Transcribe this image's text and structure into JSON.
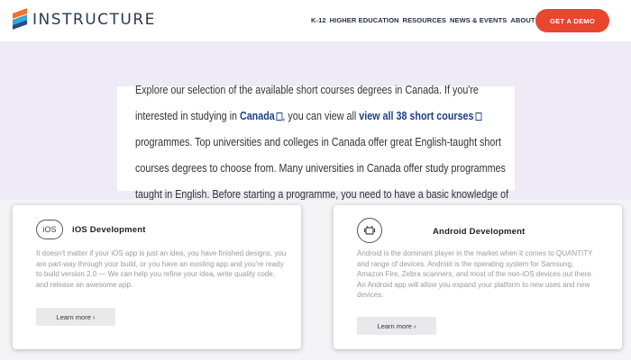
{
  "header": {
    "logo_text": "INSTRUCTURE",
    "nav": [
      {
        "label": "K-12"
      },
      {
        "label": "HIGHER EDUCATION"
      },
      {
        "label": "RESOURCES"
      },
      {
        "label": "NEWS & EVENTS"
      },
      {
        "label": "ABOUT US"
      }
    ],
    "cta_label": "GET A DEMO"
  },
  "hero": {
    "text_1": "Explore our selection of the available short courses degrees in Canada. If you're interested in studying in ",
    "link_canada": "Canada",
    "text_2": ", you can view all ",
    "link_all": "view all 38 short courses",
    "text_3": " programmes. Top universities and colleges in Canada offer great English-taught short courses degrees to choose from. Many universities in Canada offer study programmes taught in English. Before starting a programme, you need to have a basic knowledge of the English language."
  },
  "cards": [
    {
      "icon_label": "iOS",
      "title": "iOS Development",
      "body": "It doesn't matter if your iOS app is just an idea, you have finished designs, you are part-way through your build, or you have an existing app and you're ready to build version 2.0 — We can help you refine your idea, write quality code, and release an awesome app.",
      "button": "Learn more ›"
    },
    {
      "icon_label": "android-icon",
      "title": "Android Development",
      "body": "Android is the dominant player in the market when it comes to QUANTITY and range of devices. Android is the operating system for Samsung, Amazon Fire, Zebra scanners, and most of the non-iOS devices out there.",
      "body_2": "An Android app will allow you expand your platform to new uses and new devices.",
      "button": "Learn more ›"
    }
  ],
  "colors": {
    "cta": "#e8462e",
    "link": "#1e3f8a",
    "hero_bg": "#efebf6"
  }
}
